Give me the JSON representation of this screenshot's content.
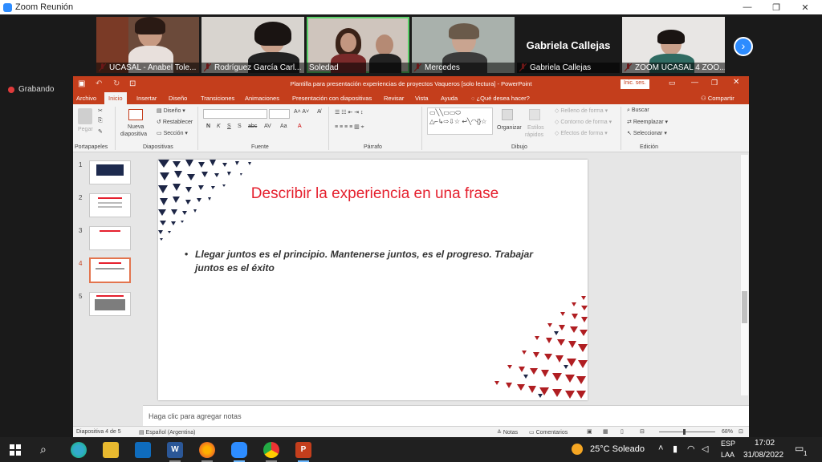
{
  "zoom": {
    "window_title": "Zoom Reunión",
    "recording_label": "Grabando",
    "participants": [
      {
        "name": "UCASAL - Anabel Tole..."
      },
      {
        "name": "Rodríguez García Carl..."
      },
      {
        "name": "Soledad"
      },
      {
        "name": "Mercedes"
      },
      {
        "name": "Gabriela Callejas",
        "big_label": "Gabriela Callejas"
      },
      {
        "name": "ZOOM UCASAL 4 ZOO..."
      }
    ],
    "next_icon": "chevron-right-icon"
  },
  "ppt": {
    "title": "Plantilla para presentación experiencias de proyectos Vaqueros [solo lectura] - PowerPoint",
    "signin": "Inic. ses.",
    "tabs": [
      "Archivo",
      "Inicio",
      "Insertar",
      "Diseño",
      "Transiciones",
      "Animaciones",
      "Presentación con diapositivas",
      "Revisar",
      "Vista",
      "Ayuda"
    ],
    "active_tab": "Inicio",
    "tell_me": "¿Qué desea hacer?",
    "share": "Compartir",
    "ribbon": {
      "clipboard": {
        "paste": "Pegar",
        "group": "Portapapeles"
      },
      "slides": {
        "new_slide_1": "Nueva",
        "new_slide_2": "diapositiva",
        "layout": "Diseño",
        "reset": "Restablecer",
        "section": "Sección",
        "group": "Diapositivas"
      },
      "font": {
        "group": "Fuente",
        "bold": "N",
        "italic": "K",
        "underline": "S",
        "shadow": "S",
        "strike": "abc",
        "spacing": "AV",
        "case": "Aa"
      },
      "paragraph": {
        "group": "Párrafo"
      },
      "drawing": {
        "arrange": "Organizar",
        "quick_styles_1": "Estilos",
        "quick_styles_2": "rápidos",
        "fill": "Relleno de forma",
        "outline": "Contorno de forma",
        "effects": "Efectos de forma",
        "group": "Dibujo"
      },
      "editing": {
        "find": "Buscar",
        "replace": "Reemplazar",
        "select": "Seleccionar",
        "group": "Edición"
      }
    },
    "thumbnails": [
      "1",
      "2",
      "3",
      "4",
      "5"
    ],
    "active_slide": "4",
    "slide": {
      "title": "Describir la experiencia en una frase",
      "bullet_marker": "•",
      "bullet": "Llegar juntos es el principio. Mantenerse juntos, es el progreso. Trabajar juntos es el éxito"
    },
    "notes_placeholder": "Haga clic para agregar notas",
    "status": {
      "slide_of": "Diapositiva 4 de 5",
      "language": "Español (Argentina)",
      "notes": "Notas",
      "comments": "Comentarios",
      "zoom": "68%"
    }
  },
  "taskbar": {
    "weather": "25°C  Soleado",
    "lang_1": "ESP",
    "lang_2": "LAA",
    "time": "17:02",
    "date": "31/08/2022",
    "notifications": "1"
  },
  "colors": {
    "ppt_accent": "#c43e1c",
    "slide_title": "#e5202e",
    "zoom_blue": "#2d8cff"
  }
}
